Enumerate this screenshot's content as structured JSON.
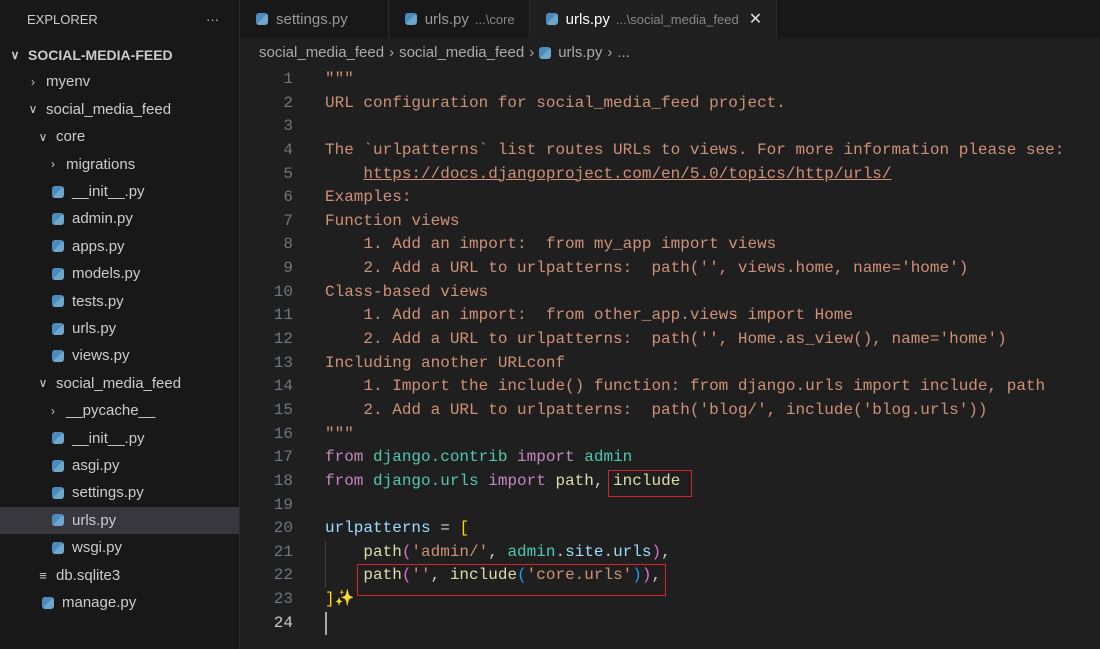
{
  "explorer": {
    "title": "EXPLORER",
    "more": "···",
    "tree": [
      {
        "label": "SOCIAL-MEDIA-FEED",
        "type": "folder-open",
        "level": 0
      },
      {
        "label": "myenv",
        "type": "folder",
        "level": 1
      },
      {
        "label": "social_media_feed",
        "type": "folder-open",
        "level": 1
      },
      {
        "label": "core",
        "type": "folder-open",
        "level": 2
      },
      {
        "label": "migrations",
        "type": "folder",
        "level": 3
      },
      {
        "label": "__init__.py",
        "type": "py",
        "level": 3
      },
      {
        "label": "admin.py",
        "type": "py",
        "level": 3
      },
      {
        "label": "apps.py",
        "type": "py",
        "level": 3
      },
      {
        "label": "models.py",
        "type": "py",
        "level": 3
      },
      {
        "label": "tests.py",
        "type": "py",
        "level": 3
      },
      {
        "label": "urls.py",
        "type": "py",
        "level": 3
      },
      {
        "label": "views.py",
        "type": "py",
        "level": 3
      },
      {
        "label": "social_media_feed",
        "type": "folder-open",
        "level": 2
      },
      {
        "label": "__pycache__",
        "type": "folder",
        "level": 3
      },
      {
        "label": "__init__.py",
        "type": "py",
        "level": 3
      },
      {
        "label": "asgi.py",
        "type": "py",
        "level": 3
      },
      {
        "label": "settings.py",
        "type": "py",
        "level": 3
      },
      {
        "label": "urls.py",
        "type": "py",
        "level": 3,
        "selected": true
      },
      {
        "label": "wsgi.py",
        "type": "py",
        "level": 3
      },
      {
        "label": "db.sqlite3",
        "type": "db",
        "level": 2
      },
      {
        "label": "manage.py",
        "type": "py",
        "level": 2
      }
    ]
  },
  "tabs": [
    {
      "label": "settings.py",
      "desc": ""
    },
    {
      "label": "urls.py",
      "desc": "...\\core"
    },
    {
      "label": "urls.py",
      "desc": "...\\social_media_feed",
      "active": true,
      "close": "✕"
    }
  ],
  "breadcrumb": [
    "social_media_feed",
    "social_media_feed",
    "urls.py",
    "..."
  ],
  "breadcrumb_sep": "›",
  "code": [
    [
      [
        "\"\"\"",
        "doc"
      ]
    ],
    [
      [
        "URL configuration for social_media_feed project.",
        "doc"
      ]
    ],
    [],
    [
      [
        "The `urlpatterns` list routes URLs to views. For more information please see:",
        "doc"
      ]
    ],
    [
      [
        "    ",
        "doc"
      ],
      [
        "https://docs.djangoproject.com/en/5.0/topics/http/urls/",
        "link"
      ]
    ],
    [
      [
        "Examples:",
        "doc"
      ]
    ],
    [
      [
        "Function views",
        "doc"
      ]
    ],
    [
      [
        "    1. Add an import:  from my_app import views",
        "doc"
      ]
    ],
    [
      [
        "    2. Add a URL to urlpatterns:  path('', views.home, name='home')",
        "doc"
      ]
    ],
    [
      [
        "Class-based views",
        "doc"
      ]
    ],
    [
      [
        "    1. Add an import:  from other_app.views import Home",
        "doc"
      ]
    ],
    [
      [
        "    2. Add a URL to urlpatterns:  path('', Home.as_view(), name='home')",
        "doc"
      ]
    ],
    [
      [
        "Including another URLconf",
        "doc"
      ]
    ],
    [
      [
        "    1. Import the include() function: from django.urls import include, path",
        "doc"
      ]
    ],
    [
      [
        "    2. Add a URL to urlpatterns:  path('blog/', include('blog.urls'))",
        "doc"
      ]
    ],
    [
      [
        "\"\"\"",
        "doc"
      ]
    ],
    [
      [
        "from",
        "kw"
      ],
      [
        " ",
        "pl"
      ],
      [
        "django.contrib",
        "mod"
      ],
      [
        " ",
        "pl"
      ],
      [
        "import",
        "kw"
      ],
      [
        " ",
        "pl"
      ],
      [
        "admin",
        "mod"
      ]
    ],
    [
      [
        "from",
        "kw"
      ],
      [
        " ",
        "pl"
      ],
      [
        "django.urls",
        "mod"
      ],
      [
        " ",
        "pl"
      ],
      [
        "import",
        "kw"
      ],
      [
        " ",
        "pl"
      ],
      [
        "path",
        "fn"
      ],
      [
        ", ",
        "pl"
      ],
      [
        "include",
        "fn"
      ]
    ],
    [],
    [
      [
        "urlpatterns",
        "var"
      ],
      [
        " = ",
        "op"
      ],
      [
        "[",
        "b1"
      ]
    ],
    [
      [
        "    ",
        "pl"
      ],
      [
        "path",
        "fn"
      ],
      [
        "(",
        "b2"
      ],
      [
        "'admin/'",
        "str"
      ],
      [
        ", ",
        "pl"
      ],
      [
        "admin",
        "mod"
      ],
      [
        ".",
        "pl"
      ],
      [
        "site",
        "var"
      ],
      [
        ".",
        "pl"
      ],
      [
        "urls",
        "var"
      ],
      [
        ")",
        "b2"
      ],
      [
        ",",
        "pl"
      ]
    ],
    [
      [
        "    ",
        "pl"
      ],
      [
        "path",
        "fn"
      ],
      [
        "(",
        "b2"
      ],
      [
        "''",
        "str"
      ],
      [
        ", ",
        "pl"
      ],
      [
        "include",
        "fn"
      ],
      [
        "(",
        "b3"
      ],
      [
        "'core.urls'",
        "str"
      ],
      [
        ")",
        "b3"
      ],
      [
        ")",
        "b2"
      ],
      [
        ",",
        "pl"
      ]
    ],
    [
      [
        "]",
        "b1"
      ],
      [
        "✨",
        "fn"
      ]
    ],
    []
  ]
}
